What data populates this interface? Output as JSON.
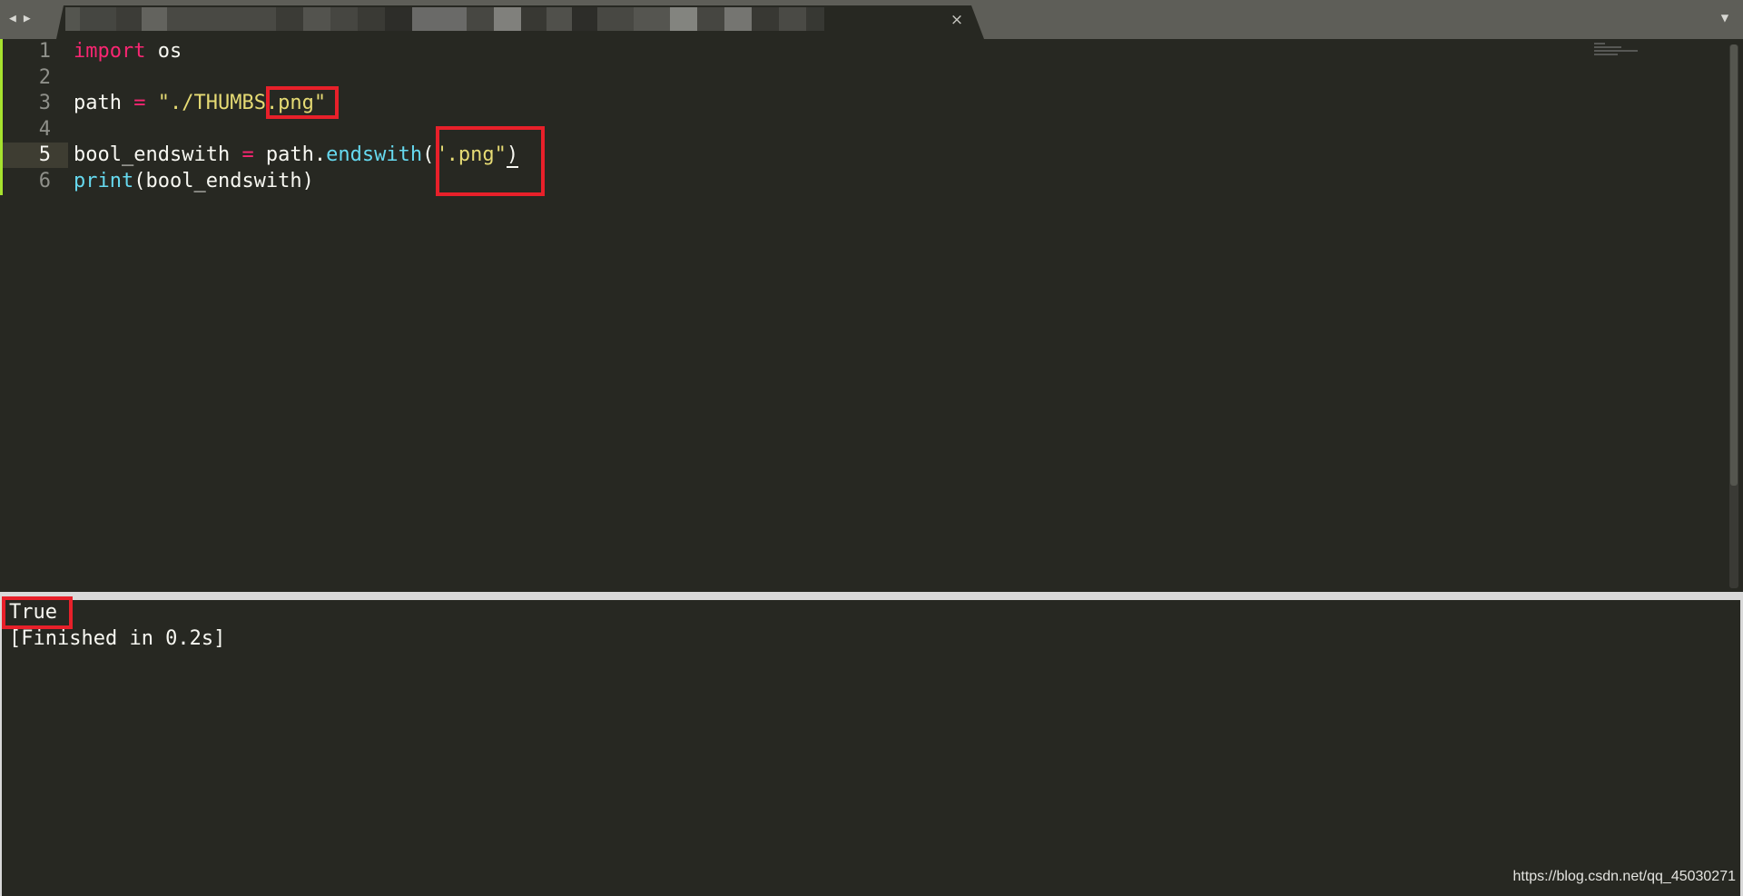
{
  "tabbar": {
    "back_icon": "back-arrow-icon",
    "forward_icon": "forward-arrow-icon",
    "back_glyph": "◀",
    "forward_glyph": "▶",
    "close_glyph": "×",
    "overflow_glyph": "▼"
  },
  "editor": {
    "lines": [
      {
        "number": "1",
        "tokens": [
          [
            "kw",
            "import"
          ],
          [
            "plain",
            " os"
          ]
        ]
      },
      {
        "number": "2",
        "tokens": []
      },
      {
        "number": "3",
        "tokens": [
          [
            "plain",
            "path "
          ],
          [
            "op",
            "="
          ],
          [
            "plain",
            " "
          ],
          [
            "str",
            "\"./THUMBS.png\""
          ]
        ]
      },
      {
        "number": "4",
        "tokens": []
      },
      {
        "number": "5",
        "tokens": [
          [
            "plain",
            "bool_endswith "
          ],
          [
            "op",
            "="
          ],
          [
            "plain",
            " path."
          ],
          [
            "fn",
            "endswith"
          ],
          [
            "plain",
            "("
          ],
          [
            "str",
            "\".png\""
          ],
          [
            "cursor",
            ")"
          ]
        ],
        "current": true
      },
      {
        "number": "6",
        "tokens": [
          [
            "fn",
            "print"
          ],
          [
            "plain",
            "(bool_endswith)"
          ]
        ]
      }
    ],
    "gutter_color": "#a6e22e",
    "highlight_color": "#e8202a"
  },
  "output": {
    "lines": [
      "True",
      "[Finished in 0.2s]"
    ]
  },
  "watermark": "https://blog.csdn.net/qq_45030271"
}
